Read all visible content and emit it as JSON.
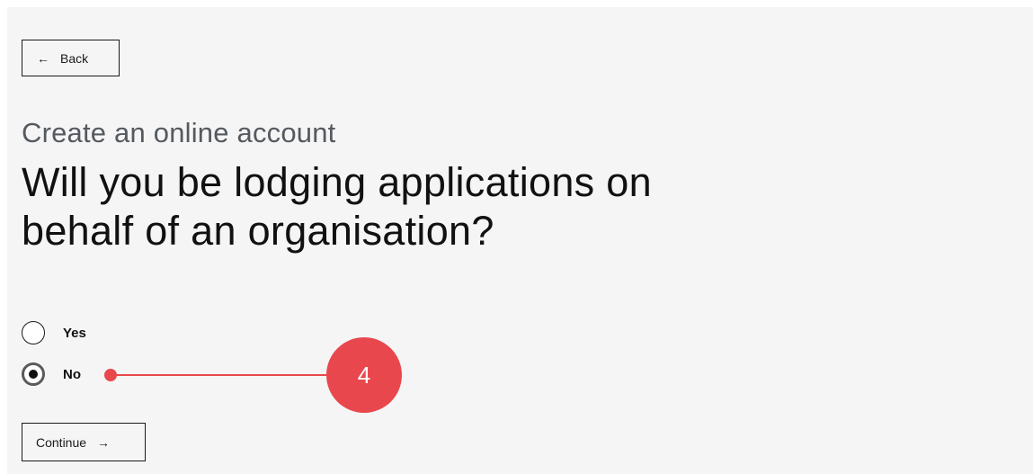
{
  "navigation": {
    "back_label": "Back",
    "back_arrow": "←"
  },
  "form": {
    "subtitle": "Create an online account",
    "question": "Will you be lodging applications on behalf of an organisation?",
    "options": [
      {
        "label": "Yes",
        "selected": false
      },
      {
        "label": "No",
        "selected": true
      }
    ],
    "continue_label": "Continue",
    "continue_arrow": "→"
  },
  "annotation": {
    "number": "4",
    "color": "#e8484d"
  }
}
